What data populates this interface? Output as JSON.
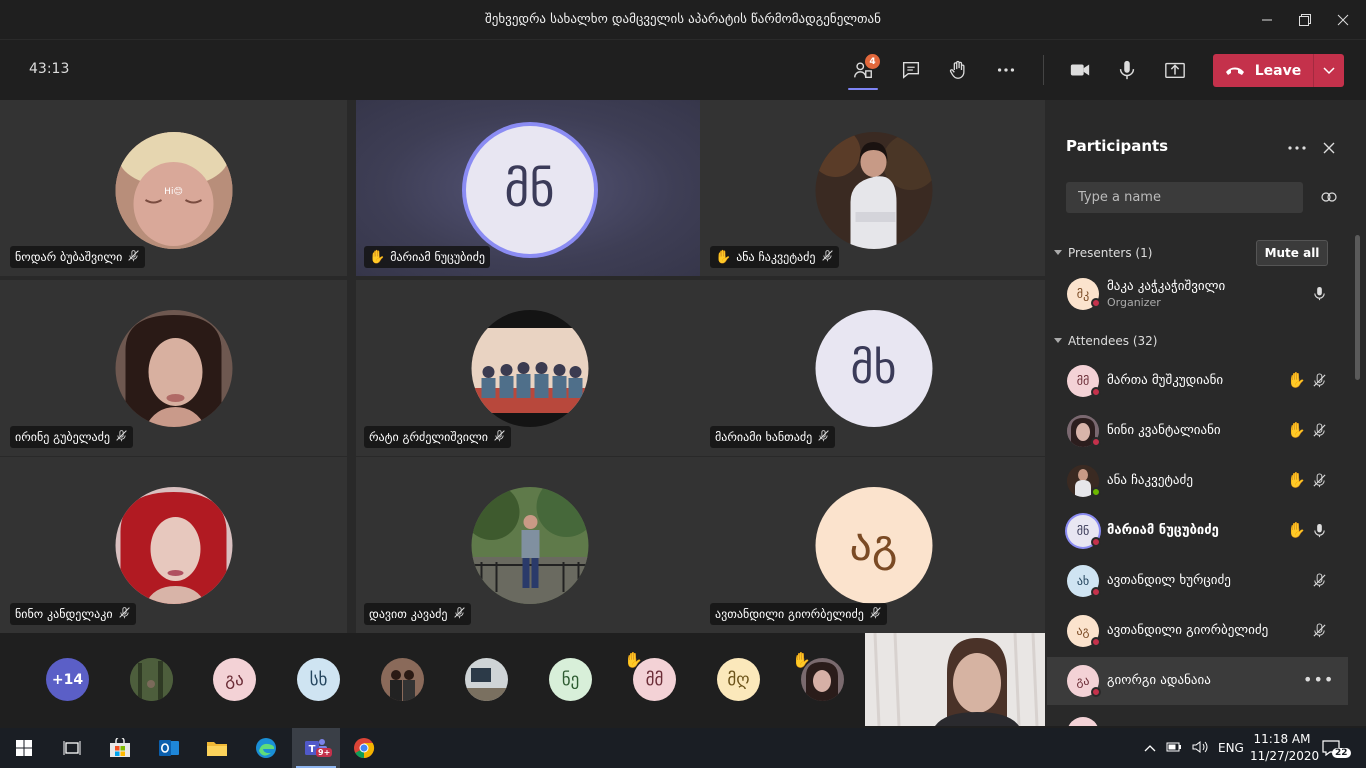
{
  "window": {
    "title": "შეხვედრა სახალხო დამცველის აპარატის წარმომადგენელთან"
  },
  "toolbar": {
    "timer": "43:13",
    "participants_badge": "4",
    "leave_label": "Leave"
  },
  "tiles": [
    {
      "name": "ნოდარ ბუბაშვილი",
      "hand": false,
      "avatar": "photo",
      "initials": ""
    },
    {
      "name": "მარიამ ნუცუბიძე",
      "hand": true,
      "avatar": "initials",
      "initials": "მნ"
    },
    {
      "name": "ანა ჩაკვეტაძე",
      "hand": true,
      "avatar": "photo",
      "initials": ""
    },
    {
      "name": "ირინე გუბელაძე",
      "hand": false,
      "avatar": "photo",
      "initials": ""
    },
    {
      "name": "რატი გრძელიშვილი",
      "hand": false,
      "avatar": "photo",
      "initials": ""
    },
    {
      "name": "მარიამი ხანთაძე",
      "hand": false,
      "avatar": "initials",
      "initials": "მხ"
    },
    {
      "name": "ნინო კანდელაკი",
      "hand": false,
      "avatar": "photo",
      "initials": ""
    },
    {
      "name": "დავით კავაძე",
      "hand": false,
      "avatar": "photo",
      "initials": ""
    },
    {
      "name": "ავთანდილი გიორბელიძე",
      "hand": false,
      "avatar": "initials",
      "initials": "აგ"
    }
  ],
  "strip": {
    "more_count": "+14",
    "avatars": [
      "გა",
      "სხ",
      "ნე",
      "მმ",
      "მღ"
    ]
  },
  "panel": {
    "title": "Participants",
    "search_placeholder": "Type a name",
    "presenters_label": "Presenters (1)",
    "attendees_label": "Attendees (32)",
    "mute_all": "Mute all",
    "presenter": {
      "name": "მაკა კაჭკაჭიშვილი",
      "role": "Organizer",
      "initials": "მკ"
    },
    "attendees": [
      {
        "name": "მართა მუშკუდიანი",
        "initials": "მმ",
        "hand": true,
        "mic": "off",
        "status": "red"
      },
      {
        "name": "ნინი კვანტალიანი",
        "initials": "",
        "hand": true,
        "mic": "off",
        "status": "red"
      },
      {
        "name": "ანა ჩაკვეტაძე",
        "initials": "",
        "hand": true,
        "mic": "off",
        "status": "green"
      },
      {
        "name": "მარიამ ნუცუბიძე",
        "initials": "მნ",
        "hand": true,
        "mic": "on",
        "status": "red"
      },
      {
        "name": "ავთანდილ ხურციძე",
        "initials": "ახ",
        "hand": false,
        "mic": "off",
        "status": "red"
      },
      {
        "name": "ავთანდილი გიორბელიძე",
        "initials": "აგ",
        "hand": false,
        "mic": "off",
        "status": "red"
      },
      {
        "name": "გიორგი ადანაია",
        "initials": "გა",
        "hand": false,
        "mic": "",
        "status": "red"
      }
    ]
  },
  "taskbar": {
    "lang": "ENG",
    "time": "11:18 AM",
    "date": "11/27/2020",
    "notifications": "22",
    "teams_badge": "9+"
  },
  "colors": {
    "accent": "#7f85f5",
    "leave": "#c4314b",
    "badge": "#e2683c"
  }
}
